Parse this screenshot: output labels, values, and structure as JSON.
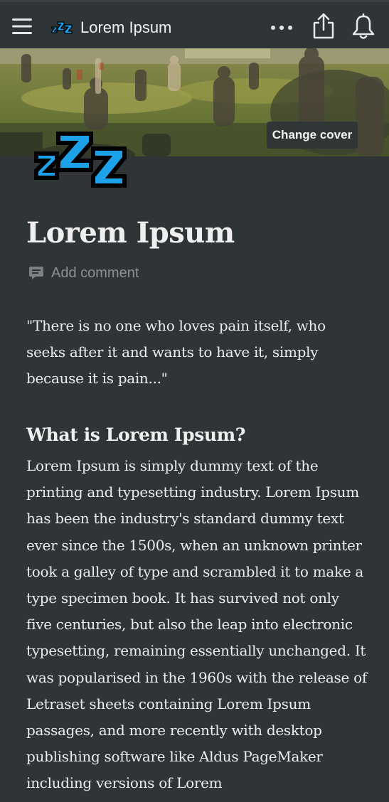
{
  "topbar": {
    "app_title": "Lorem Ipsum",
    "icons": {
      "menu": "hamburger-menu-icon",
      "page": "zzz-icon",
      "more": "more-dots-icon",
      "share": "share-icon",
      "notifications": "bell-icon"
    }
  },
  "cover": {
    "change_cover_label": "Change cover"
  },
  "page": {
    "icon": "zzz-icon",
    "title": "Lorem Ipsum",
    "add_comment_label": "Add comment"
  },
  "content": {
    "quote": "\"There is no one who loves pain itself, who seeks after it and wants to have it, simply because it is pain...\"",
    "heading": "What is Lorem Ipsum?",
    "paragraph": "Lorem Ipsum is simply dummy text of the printing and typesetting industry. Lorem Ipsum has been the industry's standard dummy text ever since the 1500s, when an unknown printer took a galley of type and scrambled it to make a type specimen book. It has survived not only five centuries, but also the leap into electronic typesetting, remaining essentially unchanged. It was popularised in the 1960s with the release of Letraset sheets containing Lorem Ipsum passages, and more recently with desktop publishing software like Aldus PageMaker including versions of Lorem"
  },
  "colors": {
    "background": "#2f3437",
    "icon_blue": "#1da1e8",
    "muted_text": "#8e9193"
  }
}
